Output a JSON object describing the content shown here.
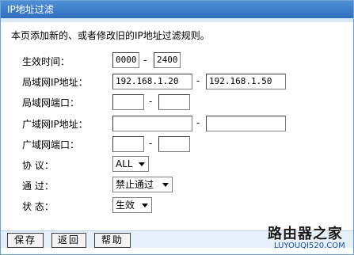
{
  "window": {
    "title": "IP地址过滤"
  },
  "description": "本页添加新的、或者修改旧的IP地址过滤规则。",
  "form": {
    "effective_time": {
      "label": "生效时间：",
      "start": "0000",
      "end": "2400",
      "separator": "-"
    },
    "lan_ip": {
      "label": "局域网IP地址：",
      "start": "192.168.1.20",
      "end": "192.168.1.50",
      "separator": "-"
    },
    "lan_port": {
      "label": "局域网端口：",
      "start": "",
      "end": "",
      "separator": "-"
    },
    "wan_ip": {
      "label": "广域网IP地址：",
      "start": "",
      "end": "",
      "separator": "-"
    },
    "wan_port": {
      "label": "广域网端口：",
      "start": "",
      "end": "",
      "separator": "-"
    },
    "protocol": {
      "label": "协 议：",
      "value": "ALL"
    },
    "pass": {
      "label": "通 过：",
      "value": "禁止通过"
    },
    "status": {
      "label": "状 态：",
      "value": "生效"
    }
  },
  "buttons": {
    "save": "保存",
    "back": "返回",
    "help": "帮助"
  },
  "watermark": {
    "title": "路由器之家",
    "url": "LUYOUQI520.COM"
  },
  "icons": {
    "dropdown": "chevron-down-icon"
  }
}
